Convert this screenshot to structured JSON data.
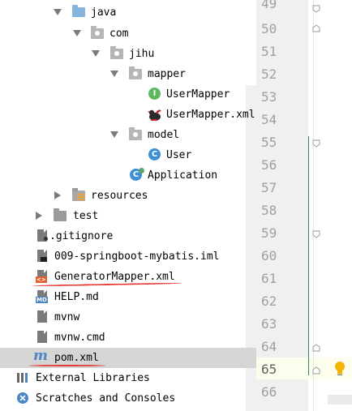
{
  "tree": {
    "items": [
      {
        "label": "java"
      },
      {
        "label": "com"
      },
      {
        "label": "jihu"
      },
      {
        "label": "mapper"
      },
      {
        "label": "UserMapper",
        "icon_letter": "I"
      },
      {
        "label": "UserMapper.xml"
      },
      {
        "label": "model"
      },
      {
        "label": "User",
        "icon_letter": "C"
      },
      {
        "label": "Application",
        "icon_letter": "C"
      },
      {
        "label": "resources"
      },
      {
        "label": "test"
      },
      {
        "label": ".gitignore"
      },
      {
        "label": "009-springboot-mybatis.iml"
      },
      {
        "label": "GeneratorMapper.xml",
        "badge": "<>"
      },
      {
        "label": "HELP.md",
        "badge": "MD"
      },
      {
        "label": "mvnw"
      },
      {
        "label": "mvnw.cmd"
      },
      {
        "label": "pom.xml",
        "icon_letter": "m"
      },
      {
        "label": "External Libraries"
      },
      {
        "label": "Scratches and Consoles"
      }
    ]
  },
  "gutter": {
    "line_numbers": [
      "49",
      "50",
      "51",
      "52",
      "53",
      "54",
      "55",
      "56",
      "57",
      "58",
      "59",
      "60",
      "61",
      "62",
      "63",
      "64",
      "65",
      "66"
    ]
  },
  "colors": {
    "interface_icon": "#5fb85f",
    "class_icon": "#3d8fd6",
    "annotation_red": "#e53935",
    "selection": "#d5d5d5",
    "bulb": "#f5b400"
  }
}
